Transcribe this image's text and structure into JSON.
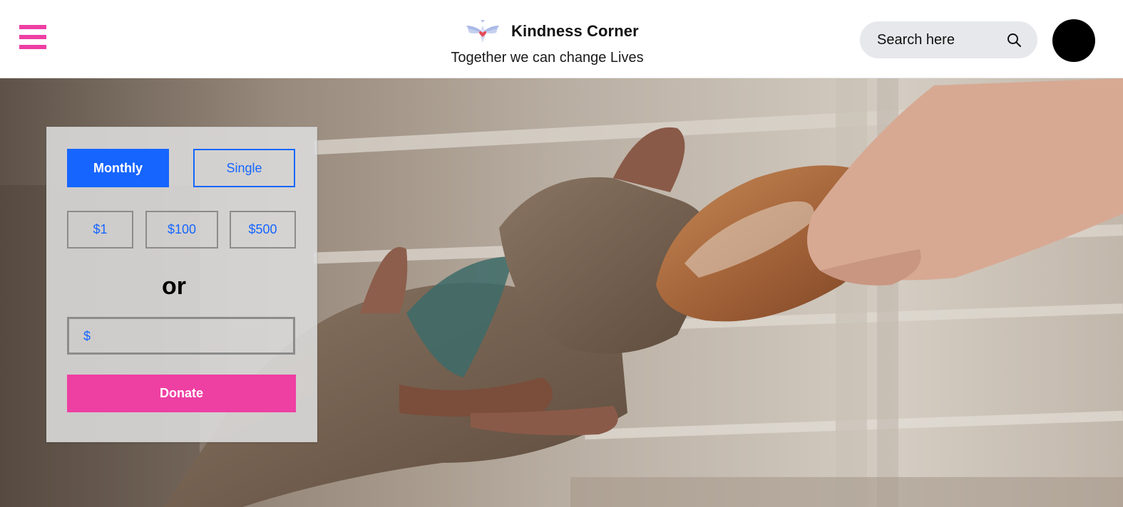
{
  "header": {
    "menu_icon": "hamburger-menu-icon",
    "brand_title": "Kindness Corner",
    "tagline": "Together we can change Lives",
    "logo_icon": "dove-heart-logo",
    "search_placeholder": "Search here",
    "search_icon": "search-icon",
    "avatar": "user-avatar"
  },
  "hero": {
    "image": "hands-sharing-bread-photo"
  },
  "donation": {
    "frequency": {
      "monthly": "Monthly",
      "single": "Single",
      "selected": "Monthly"
    },
    "amounts": [
      "$1",
      "$100",
      "$500"
    ],
    "or_label": "or",
    "custom_prefix": "$",
    "custom_value": "",
    "donate_label": "Donate"
  },
  "colors": {
    "accent_pink": "#ee3fa3",
    "accent_blue": "#1665ff",
    "search_bg": "#e7e8ec",
    "card_bg": "#dddddd"
  }
}
